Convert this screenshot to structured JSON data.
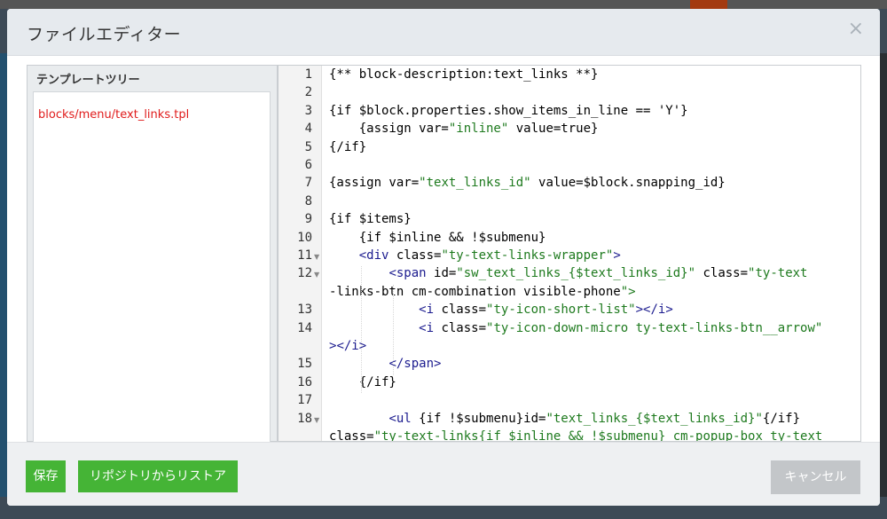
{
  "modal": {
    "title": "ファイルエディター",
    "close_glyph": "×"
  },
  "tree": {
    "heading": "テンプレートツリー",
    "items": [
      "blocks/menu/text_links.tpl"
    ]
  },
  "editor": {
    "lines": [
      {
        "n": "1",
        "text": "{** block-description:text_links **}"
      },
      {
        "n": "2",
        "text": ""
      },
      {
        "n": "3",
        "text": "{if $block.properties.show_items_in_line == 'Y'}"
      },
      {
        "n": "4",
        "text": "    {assign var=\"inline\" value=true}"
      },
      {
        "n": "5",
        "text": "{/if}"
      },
      {
        "n": "6",
        "text": ""
      },
      {
        "n": "7",
        "text": "{assign var=\"text_links_id\" value=$block.snapping_id}"
      },
      {
        "n": "8",
        "text": ""
      },
      {
        "n": "9",
        "text": "{if $items}"
      },
      {
        "n": "10",
        "text": "    {if $inline && !$submenu}"
      },
      {
        "n": "11",
        "text": "    <div class=\"ty-text-links-wrapper\">"
      },
      {
        "n": "12",
        "text": "        <span id=\"sw_text_links_{$text_links_id}\" class=\"ty-text"
      },
      {
        "n": "",
        "text": "-links-btn cm-combination visible-phone\">"
      },
      {
        "n": "13",
        "text": "            <i class=\"ty-icon-short-list\"></i>"
      },
      {
        "n": "14",
        "text": "            <i class=\"ty-icon-down-micro ty-text-links-btn__arrow\""
      },
      {
        "n": "",
        "text": "></i>"
      },
      {
        "n": "15",
        "text": "        </span>"
      },
      {
        "n": "16",
        "text": "    {/if}"
      },
      {
        "n": "17",
        "text": ""
      },
      {
        "n": "18",
        "text": "        <ul {if !$submenu}id=\"text_links_{$text_links_id}\"{/if}"
      },
      {
        "n": "",
        "text": "class=\"ty-text-links{if $inline && !$submenu} cm-popup-box ty-text"
      }
    ],
    "fold_markers": [
      "11",
      "12",
      "18"
    ]
  },
  "footer": {
    "save_label": "保存",
    "restore_label": "リポジトリからリストア",
    "cancel_label": "キャンセル"
  },
  "colors": {
    "primary_button": "#45b436",
    "cancel_button": "#c3c6c9",
    "tree_item": "#e01b1b",
    "code_tag": "#1c1c8f",
    "code_string": "#1e7a1e"
  }
}
